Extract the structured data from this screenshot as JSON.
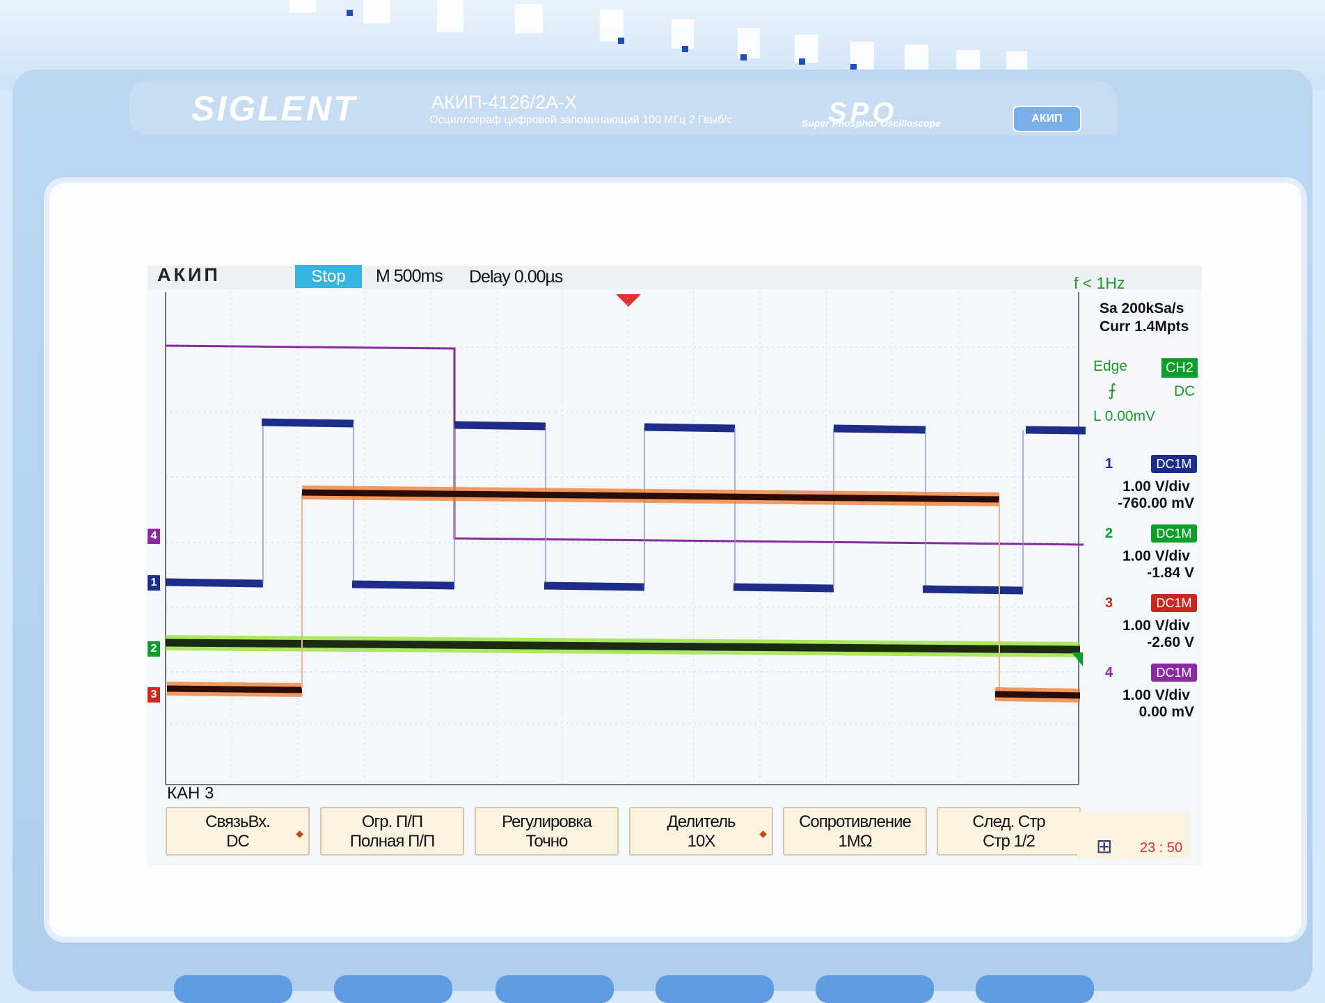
{
  "device": {
    "brand": "SIGLENT",
    "model": "АКИП-4126/2А-Х",
    "subtitle": "Осциллограф цифровой запоминающий  100 МГц  2 Гвыб/с",
    "tech": "SPO",
    "tech_sub": "Super Phosphor Oscilloscope",
    "badge": "АКИП"
  },
  "screen": {
    "logo": "АКИП",
    "run_state": "Stop",
    "timebase": "M 500ms",
    "delay": "Delay 0.00µs",
    "freq": "f < 1Hz",
    "sample_rate": "Sa 200kSa/s",
    "memory": "Curr 1.4Mpts",
    "trigger": {
      "type": "Edge",
      "source": "CH2",
      "slope_icon": "rising-edge-icon",
      "coupling": "DC",
      "level": "L  0.00mV"
    },
    "channels": [
      {
        "num": "1",
        "coupling": "DC1M",
        "vdiv": "1.00 V/div",
        "offset": "-760.00 mV",
        "color": "#1e2d8a"
      },
      {
        "num": "2",
        "coupling": "DC1M",
        "vdiv": "1.00 V/div",
        "offset": "-1.84 V",
        "color": "#0e9f2b"
      },
      {
        "num": "3",
        "coupling": "DC1M",
        "vdiv": "1.00 V/div",
        "offset": "-2.60 V",
        "color": "#c9281e"
      },
      {
        "num": "4",
        "coupling": "DC1M",
        "vdiv": "1.00 V/div",
        "offset": "0.00 mV",
        "color": "#8a2aa0"
      }
    ],
    "channel_markers": [
      "4",
      "1",
      "2",
      "3"
    ],
    "menu_title": "КАН 3",
    "softkeys": [
      {
        "line1": "СвязьВх.",
        "line2": "DC"
      },
      {
        "line1": "Огр. П/П",
        "line2": "Полная П/П"
      },
      {
        "line1": "Регулировка",
        "line2": "Точно"
      },
      {
        "line1": "Делитель",
        "line2": "10X"
      },
      {
        "line1": "Сопротивление",
        "line2": "1MΩ"
      },
      {
        "line1": "След. Стр",
        "line2": "Стр 1/2"
      }
    ],
    "clock": "23 : 50",
    "network_icon": "network-icon"
  },
  "colors": {
    "ch1": "#1e2d8a",
    "ch2": "#0e9f2b",
    "ch3": "#c9281e",
    "ch4": "#8a2aa0",
    "accent": "#35b4dd",
    "trigger_marker": "#e0302b"
  }
}
